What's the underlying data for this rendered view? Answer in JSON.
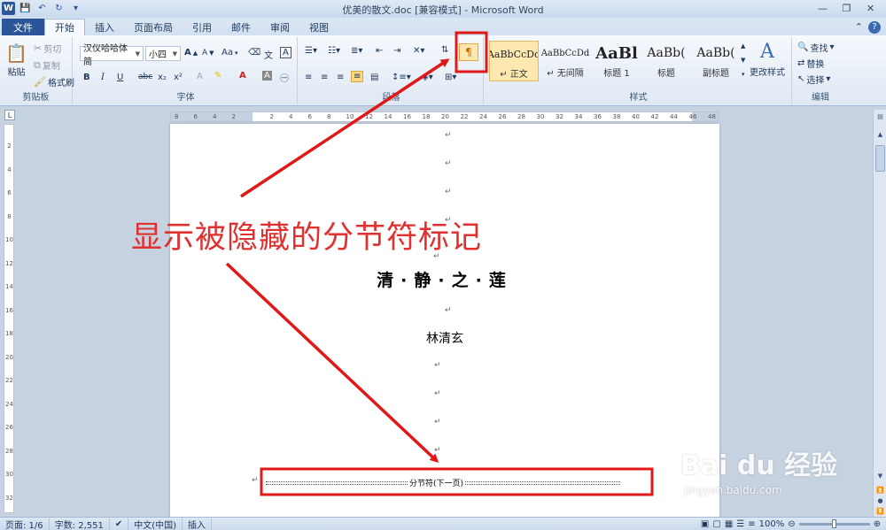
{
  "window": {
    "title": "优美的散文.doc [兼容模式] - Microsoft Word",
    "app_logo": "W"
  },
  "tabs": [
    "文件",
    "开始",
    "插入",
    "页面布局",
    "引用",
    "邮件",
    "审阅",
    "视图"
  ],
  "ribbon": {
    "clipboard": {
      "paste": "粘贴",
      "cut": "剪切",
      "copy": "复制",
      "format_painter": "格式刷",
      "group": "剪贴板"
    },
    "font": {
      "font_name": "汉仪哈哈体简",
      "font_size": "小四",
      "group": "字体",
      "bold": "B",
      "italic": "I",
      "underline": "U",
      "strike": "abc",
      "sub": "x₂",
      "sup": "x²",
      "change_case": "Aa",
      "grow": "A",
      "shrink": "A"
    },
    "paragraph": {
      "group": "段落"
    },
    "styles": {
      "group": "样式",
      "items": [
        {
          "sample": "AaBbCcDd",
          "name": "↵ 正文"
        },
        {
          "sample": "AaBbCcDd",
          "name": "↵ 无间隔"
        },
        {
          "sample": "AaBl",
          "name": "标题 1"
        },
        {
          "sample": "AaBb(",
          "name": "标题"
        },
        {
          "sample": "AaBb(",
          "name": "副标题"
        }
      ],
      "change_styles": "更改样式"
    },
    "editing": {
      "find": "查找",
      "replace": "替换",
      "select": "选择",
      "group": "编辑"
    }
  },
  "ruler": {
    "h_ticks": [
      "8",
      "6",
      "4",
      "2",
      "",
      "2",
      "4",
      "6",
      "8",
      "10",
      "12",
      "14",
      "16",
      "18",
      "20",
      "22",
      "24",
      "26",
      "28",
      "30",
      "32",
      "34",
      "36",
      "38",
      "40",
      "42",
      "44",
      "46",
      "48"
    ],
    "v_ticks": [
      "2",
      "4",
      "6",
      "8",
      "10",
      "12",
      "14",
      "16",
      "18",
      "20",
      "22",
      "24",
      "26",
      "28",
      "30",
      "32"
    ],
    "tab_selector": "L"
  },
  "document": {
    "title": "清·静·之·莲",
    "author": "林清玄",
    "section_break_label": "分节符(下一页)",
    "pilcrow": "↵"
  },
  "status": {
    "page": "页面: 1/6",
    "words": "字数: 2,551",
    "language": "中文(中国)",
    "mode": "插入",
    "zoom": "100%"
  },
  "annotation": {
    "callout": "显示被隐藏的分节符标记",
    "color": "#e03030"
  },
  "watermark": {
    "brand": "Bai du 经验",
    "site": "jingyan.baidu.com"
  },
  "colors": {
    "file_tab": "#2a5699",
    "ribbon": "#f6f9fd",
    "highlight": "#fde9b0"
  }
}
